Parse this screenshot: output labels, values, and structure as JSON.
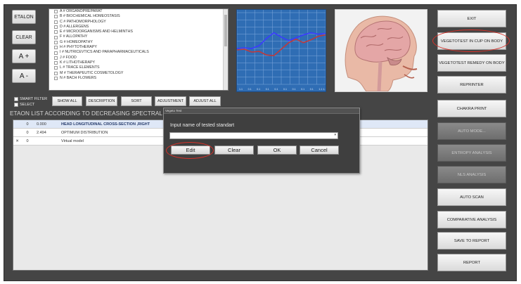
{
  "left_buttons": {
    "etalon": "ETALON",
    "clear": "CLEAR",
    "plus": "A +",
    "minus": "A -"
  },
  "categories": [
    "A # ORGANOPREPARAT",
    "B # BIOCHEMICAL HOMEOSTASIS",
    "C # PATHOMORPHOLOGY",
    "D # ALLERGENS",
    "E # MICROORGANISMS AND HELMINTHS",
    "F # ALLOPATHY",
    "G # HOMEOPATHY",
    "H # PHYTOTHERAPY",
    "I # NUTRICEVTICS AND PARAPHARMACEUTICALS",
    "J # FOOD",
    "K # LITHOTHERAPY",
    "L # TRACE ELEMENTS",
    "M # THERAPEUTIC COSMETOLOGY",
    "N # BACH FLOWERS"
  ],
  "filters": {
    "smart_filter": "SMART FILTER",
    "select": "SELECT"
  },
  "toolbar": {
    "show_all": "SHOW ALL",
    "description": "DESCRIPTION",
    "sort": "SORT",
    "adjustment": "ADJUSTMENT",
    "adjust_all": "ADJUST ALL"
  },
  "list_title": "ETAON LIST ACCORDING TO DECREASING SPECTRAL SIM",
  "rows": [
    {
      "col1": "",
      "col2": "0",
      "col3": "0.000",
      "name": "HEAD LONGITUDINAL CROSS-SECTION ,RIGHT"
    },
    {
      "col1": "",
      "col2": "0",
      "col3": "2.494",
      "name": "OPTIMUM DISTRIBUTION"
    },
    {
      "col1": "✕",
      "col2": "0",
      "col3": "",
      "name": "Virtual model"
    }
  ],
  "chart_data": {
    "type": "line",
    "x_tick_labels": [
      "1.1",
      "0.1",
      "0.1",
      "0.1",
      "0.1",
      "0.1",
      "0.1",
      "0.1",
      "0.1",
      "1.1 1.1"
    ],
    "grid": true,
    "ylim": [
      0,
      10
    ],
    "series": [
      {
        "color": "#3a3aff",
        "values": [
          5.0,
          5.1,
          5.0,
          5.4,
          6.4,
          7.2,
          6.6,
          6.1,
          6.5,
          6.9,
          7.2,
          7.0,
          7.1
        ]
      },
      {
        "color": "#c0393b",
        "values": [
          4.8,
          4.9,
          4.5,
          4.6,
          4.1,
          4.0,
          4.9,
          5.8,
          6.3,
          5.8,
          6.2,
          6.7,
          6.9
        ]
      }
    ],
    "background": "#2f6db4"
  },
  "right_buttons": [
    {
      "label": "EXIT",
      "disabled": false
    },
    {
      "label": "VEGETOTEST IN CUP ON BODY",
      "disabled": false
    },
    {
      "label": "VEGETOTEST REMEDY ON BODY",
      "disabled": false
    },
    {
      "label": "REPRINTER",
      "disabled": false
    },
    {
      "label": "CHAKRA PRINT",
      "disabled": false
    },
    {
      "label": "AUTO MODE...",
      "disabled": true
    },
    {
      "label": "ENTROPY ANALYSIS",
      "disabled": true
    },
    {
      "label": "NLS ANALYSIS",
      "disabled": true
    },
    {
      "label": "AUTO SCAN",
      "disabled": false
    },
    {
      "label": "COMPARATIVE ANALYSIS",
      "disabled": false
    },
    {
      "label": "SAVE TO REPORT",
      "disabled": false
    },
    {
      "label": "REPORT",
      "disabled": false
    }
  ],
  "dialog": {
    "title": "Vegeto Test",
    "prompt": "Input name of tested standart",
    "input_value": "",
    "edit": "Edit",
    "clear": "Clear",
    "ok": "OK",
    "cancel": "Cancel"
  },
  "colors": {
    "highlight": "#d8322a",
    "selected_row": "#dfe8f7",
    "chart_bg": "#2f6db4"
  }
}
